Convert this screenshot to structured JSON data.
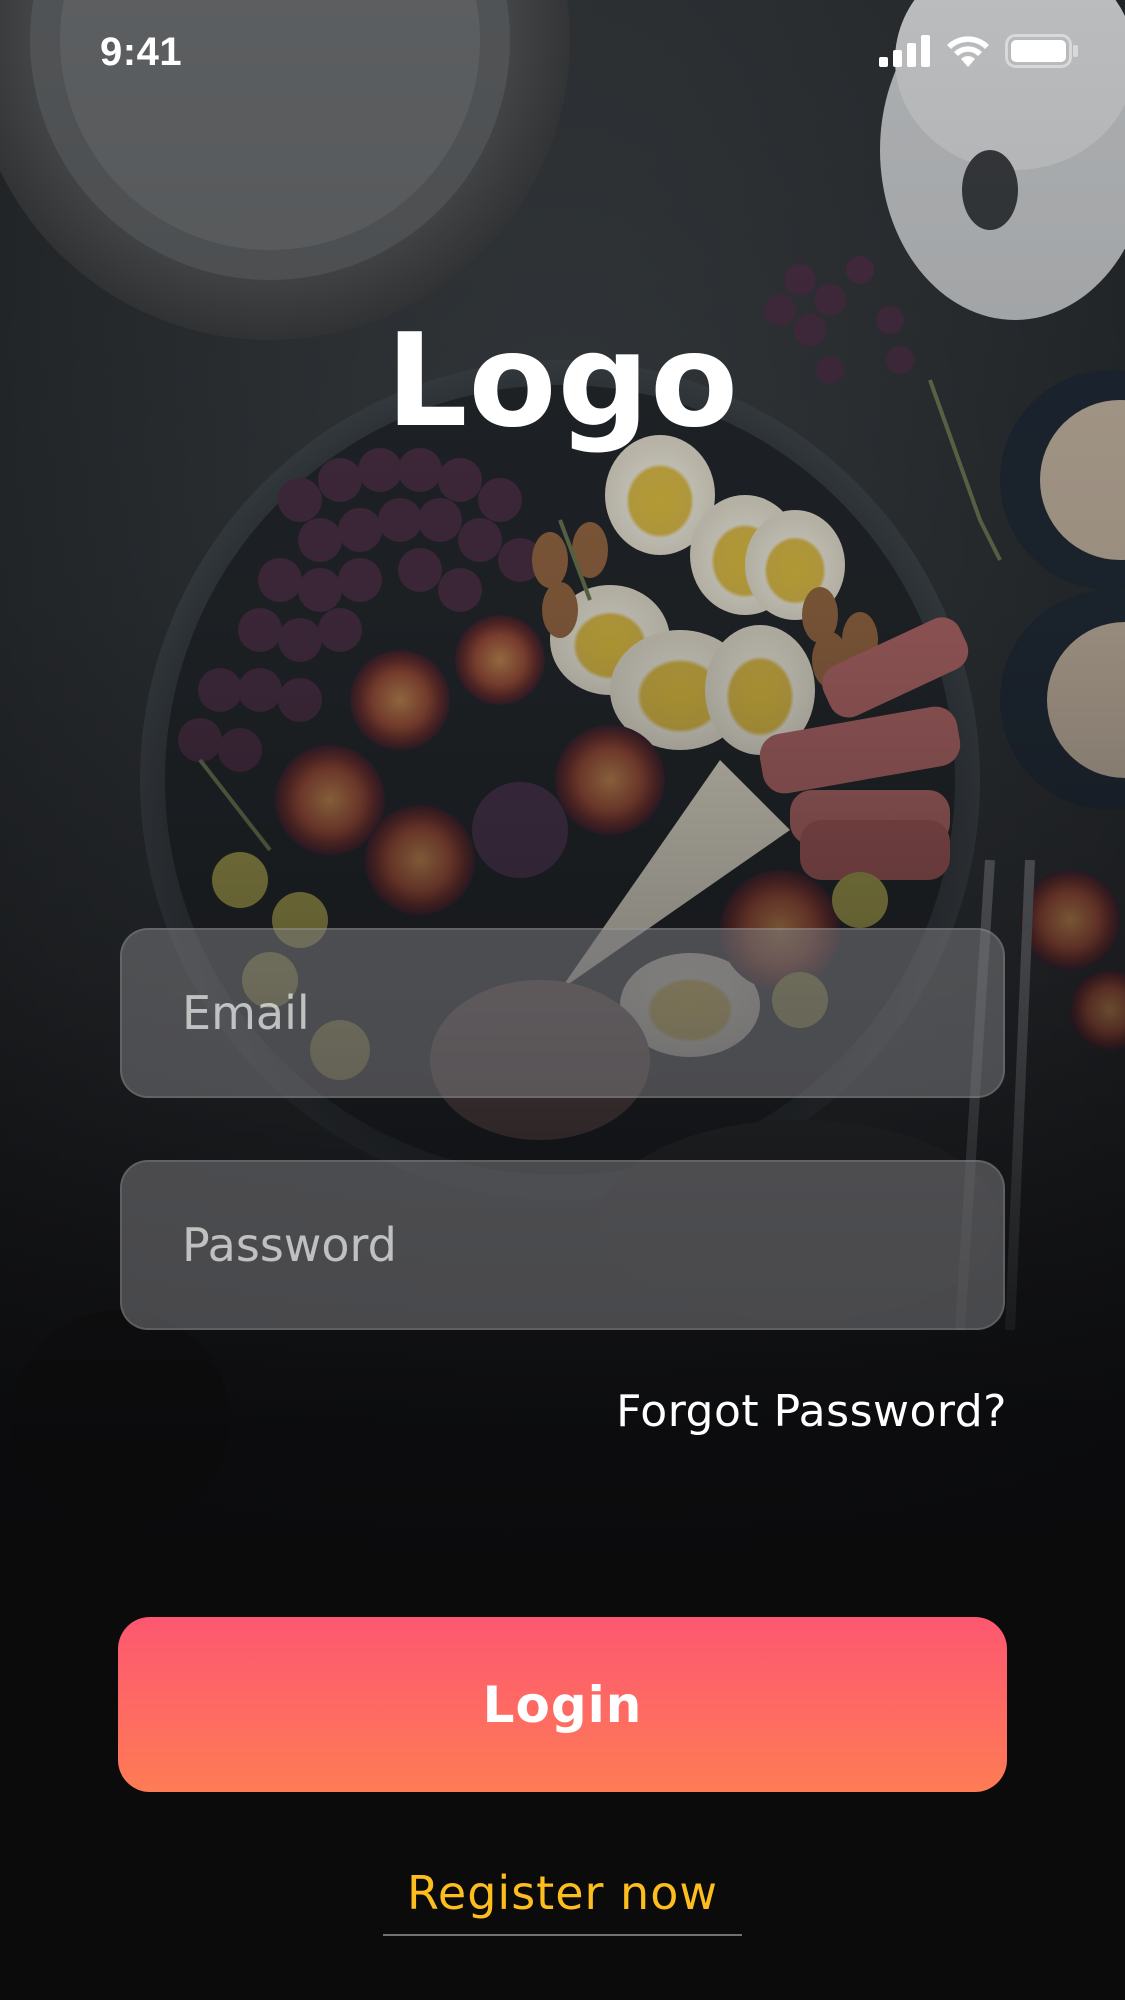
{
  "status_bar": {
    "time": "9:41",
    "icons": [
      "cellular-signal-icon",
      "wifi-icon",
      "battery-icon"
    ]
  },
  "logo": {
    "text": "Logo"
  },
  "form": {
    "email": {
      "placeholder": "Email",
      "value": ""
    },
    "password": {
      "placeholder": "Password",
      "value": ""
    },
    "forgot_password_label": "Forgot Password?",
    "login_label": "Login",
    "register_label": "Register now"
  },
  "colors": {
    "login_gradient_top": "#fd5771",
    "login_gradient_bottom": "#fe7c55",
    "register_link": "#fdbd1f",
    "background_bottom": "#0b0b0c"
  }
}
